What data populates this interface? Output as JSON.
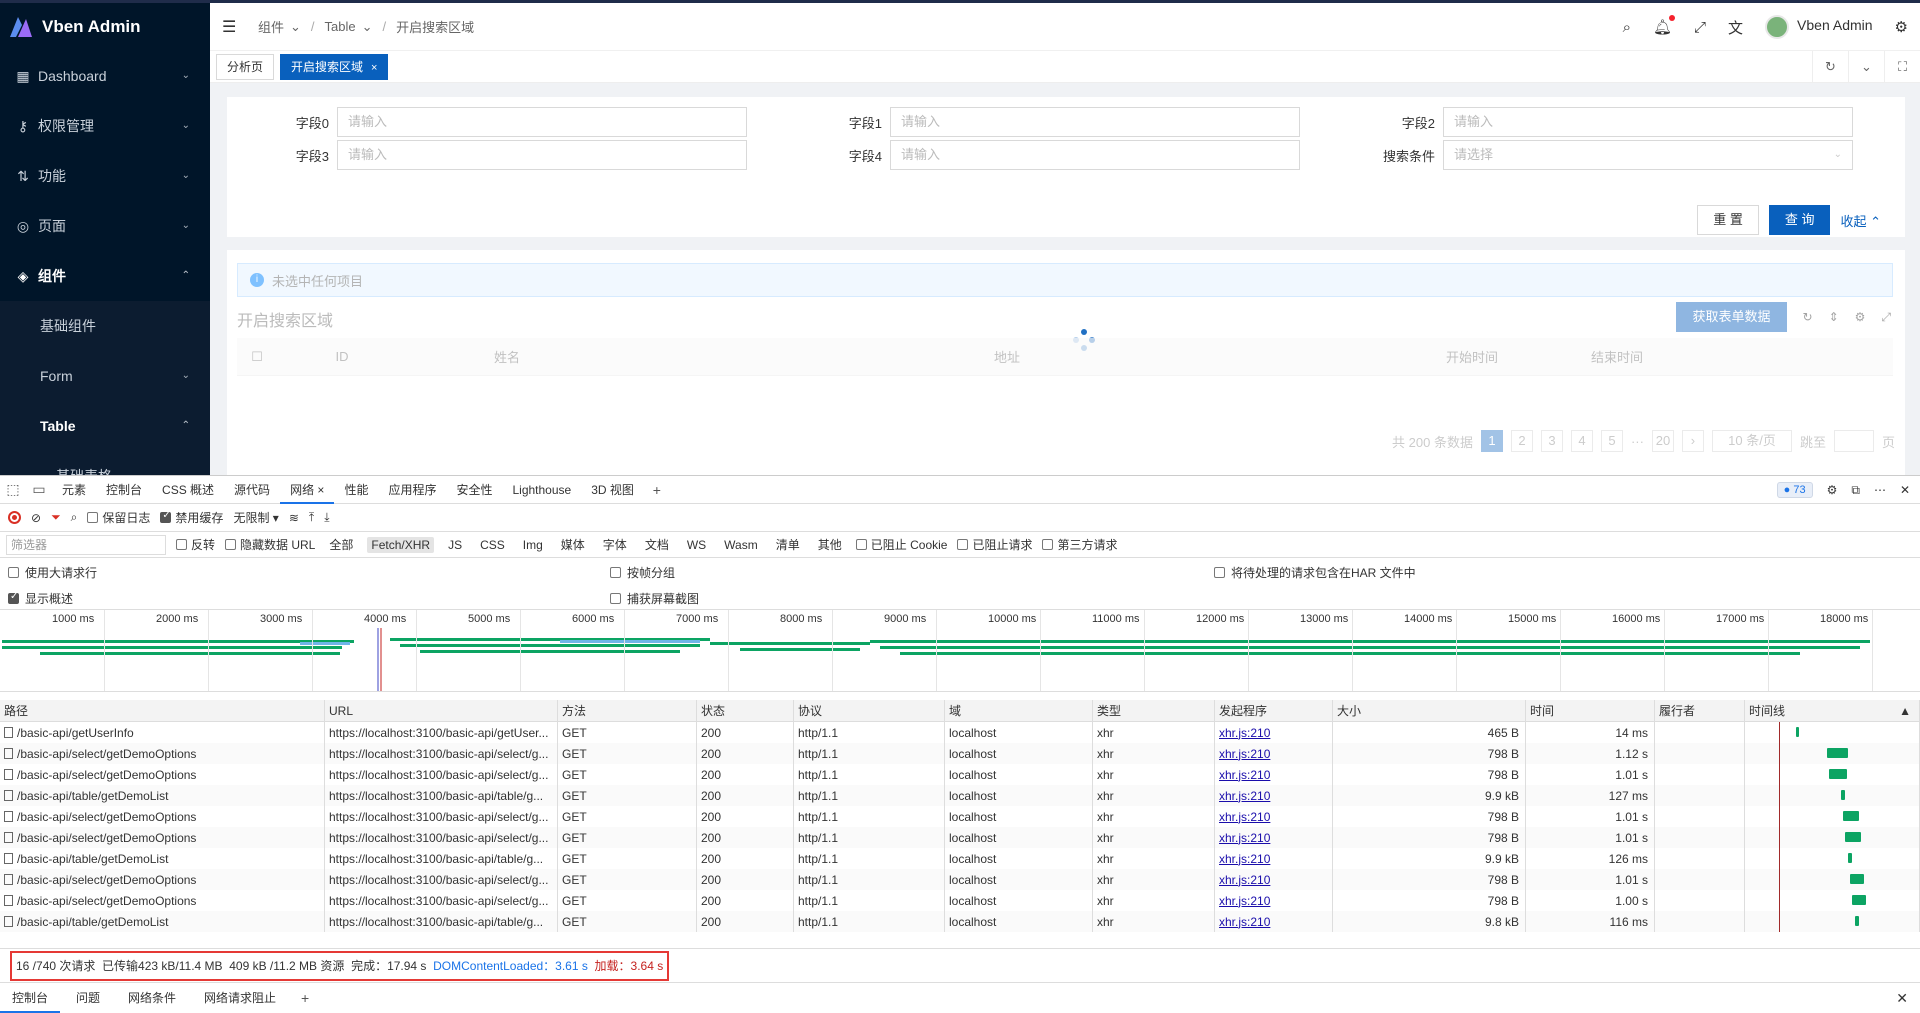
{
  "app": {
    "name": "Vben Admin",
    "user": "Vben Admin"
  },
  "sidebar": {
    "items": [
      {
        "label": "Dashboard",
        "icon": "grid-icon"
      },
      {
        "label": "权限管理",
        "icon": "key-icon"
      },
      {
        "label": "功能",
        "icon": "function-icon"
      },
      {
        "label": "页面",
        "icon": "page-icon"
      },
      {
        "label": "组件",
        "icon": "layers-icon"
      }
    ],
    "sub": [
      {
        "label": "基础组件"
      },
      {
        "label": "Form"
      },
      {
        "label": "Table"
      },
      {
        "label": "基础表格"
      }
    ]
  },
  "breadcrumb": {
    "c1": "组件",
    "c2": "Table",
    "c3": "开启搜索区域"
  },
  "tabs": {
    "t1": "分析页",
    "t2": "开启搜索区域"
  },
  "form": {
    "labels": {
      "f0": "字段0",
      "f1": "字段1",
      "f2": "字段2",
      "f3": "字段3",
      "f4": "字段4",
      "search": "搜索条件"
    },
    "placeholder_input": "请输入",
    "placeholder_select": "请选择",
    "reset": "重 置",
    "query": "查 询",
    "collapse": "收起"
  },
  "table": {
    "alert": "未选中任何项目",
    "title": "开启搜索区域",
    "fetch_btn": "获取表单数据",
    "columns": {
      "id": "ID",
      "name": "姓名",
      "addr": "地址",
      "start": "开始时间",
      "end": "结束时间"
    },
    "pager": {
      "total": "共 200 条数据",
      "p1": "1",
      "p2": "2",
      "p3": "3",
      "p4": "4",
      "p5": "5",
      "dots": "···",
      "p20": "20",
      "size": "10 条/页",
      "jump": "跳至",
      "page": "页"
    }
  },
  "devtools": {
    "tabs": {
      "elements": "元素",
      "console": "控制台",
      "css": "CSS 概述",
      "sources": "源代码",
      "network": "网络",
      "performance": "性能",
      "application": "应用程序",
      "security": "安全性",
      "lighthouse": "Lighthouse",
      "view3d": "3D 视图"
    },
    "badge": "73",
    "toolbar": {
      "preserve": "保留日志",
      "disable_cache": "禁用缓存",
      "throttle": "无限制"
    },
    "filter": {
      "placeholder": "筛选器",
      "invert": "反转",
      "hide_data": "隐藏数据 URL",
      "all": "全部",
      "fetch": "Fetch/XHR",
      "js": "JS",
      "css": "CSS",
      "img": "Img",
      "media": "媒体",
      "font": "字体",
      "doc": "文档",
      "ws": "WS",
      "wasm": "Wasm",
      "manifest": "清单",
      "other": "其他",
      "blocked_cookie": "已阻止 Cookie",
      "blocked_req": "已阻止请求",
      "third_party": "第三方请求"
    },
    "opts": {
      "big_rows": "使用大请求行",
      "group": "按帧分组",
      "har": "将待处理的请求包含在HAR 文件中",
      "overview": "显示概述",
      "screenshots": "捕获屏幕截图"
    },
    "ticks": [
      "1000 ms",
      "2000 ms",
      "3000 ms",
      "4000 ms",
      "5000 ms",
      "6000 ms",
      "7000 ms",
      "8000 ms",
      "9000 ms",
      "10000 ms",
      "11000 ms",
      "12000 ms",
      "13000 ms",
      "14000 ms",
      "15000 ms",
      "16000 ms",
      "17000 ms",
      "18000 ms"
    ],
    "columns": {
      "path": "路径",
      "url": "URL",
      "method": "方法",
      "status": "状态",
      "protocol": "协议",
      "domain": "域",
      "type": "类型",
      "initiator": "发起程序",
      "size": "大小",
      "time": "时间",
      "fulfilled": "履行者",
      "waterfall": "时间线"
    },
    "rows": [
      {
        "path": "/basic-api/getUserInfo",
        "url": "https://localhost:3100/basic-api/getUser...",
        "method": "GET",
        "status": "200",
        "protocol": "http/1.1",
        "domain": "localhost",
        "type": "xhr",
        "initiator": "xhr.js:210",
        "size": "465 B",
        "time": "14 ms",
        "wf_start": 0.29,
        "wf_len": 0.02
      },
      {
        "path": "/basic-api/select/getDemoOptions",
        "url": "https://localhost:3100/basic-api/select/g...",
        "method": "GET",
        "status": "200",
        "protocol": "http/1.1",
        "domain": "localhost",
        "type": "xhr",
        "initiator": "xhr.js:210",
        "size": "798 B",
        "time": "1.12 s",
        "wf_start": 0.47,
        "wf_len": 0.12
      },
      {
        "path": "/basic-api/select/getDemoOptions",
        "url": "https://localhost:3100/basic-api/select/g...",
        "method": "GET",
        "status": "200",
        "protocol": "http/1.1",
        "domain": "localhost",
        "type": "xhr",
        "initiator": "xhr.js:210",
        "size": "798 B",
        "time": "1.01 s",
        "wf_start": 0.48,
        "wf_len": 0.1
      },
      {
        "path": "/basic-api/table/getDemoList",
        "url": "https://localhost:3100/basic-api/table/g...",
        "method": "GET",
        "status": "200",
        "protocol": "http/1.1",
        "domain": "localhost",
        "type": "xhr",
        "initiator": "xhr.js:210",
        "size": "9.9 kB",
        "time": "127 ms",
        "wf_start": 0.55,
        "wf_len": 0.02
      },
      {
        "path": "/basic-api/select/getDemoOptions",
        "url": "https://localhost:3100/basic-api/select/g...",
        "method": "GET",
        "status": "200",
        "protocol": "http/1.1",
        "domain": "localhost",
        "type": "xhr",
        "initiator": "xhr.js:210",
        "size": "798 B",
        "time": "1.01 s",
        "wf_start": 0.56,
        "wf_len": 0.09
      },
      {
        "path": "/basic-api/select/getDemoOptions",
        "url": "https://localhost:3100/basic-api/select/g...",
        "method": "GET",
        "status": "200",
        "protocol": "http/1.1",
        "domain": "localhost",
        "type": "xhr",
        "initiator": "xhr.js:210",
        "size": "798 B",
        "time": "1.01 s",
        "wf_start": 0.57,
        "wf_len": 0.09
      },
      {
        "path": "/basic-api/table/getDemoList",
        "url": "https://localhost:3100/basic-api/table/g...",
        "method": "GET",
        "status": "200",
        "protocol": "http/1.1",
        "domain": "localhost",
        "type": "xhr",
        "initiator": "xhr.js:210",
        "size": "9.9 kB",
        "time": "126 ms",
        "wf_start": 0.59,
        "wf_len": 0.02
      },
      {
        "path": "/basic-api/select/getDemoOptions",
        "url": "https://localhost:3100/basic-api/select/g...",
        "method": "GET",
        "status": "200",
        "protocol": "http/1.1",
        "domain": "localhost",
        "type": "xhr",
        "initiator": "xhr.js:210",
        "size": "798 B",
        "time": "1.01 s",
        "wf_start": 0.6,
        "wf_len": 0.08
      },
      {
        "path": "/basic-api/select/getDemoOptions",
        "url": "https://localhost:3100/basic-api/select/g...",
        "method": "GET",
        "status": "200",
        "protocol": "http/1.1",
        "domain": "localhost",
        "type": "xhr",
        "initiator": "xhr.js:210",
        "size": "798 B",
        "time": "1.00 s",
        "wf_start": 0.61,
        "wf_len": 0.08
      },
      {
        "path": "/basic-api/table/getDemoList",
        "url": "https://localhost:3100/basic-api/table/g...",
        "method": "GET",
        "status": "200",
        "protocol": "http/1.1",
        "domain": "localhost",
        "type": "xhr",
        "initiator": "xhr.js:210",
        "size": "9.8 kB",
        "time": "116 ms",
        "wf_start": 0.63,
        "wf_len": 0.02
      }
    ],
    "summary": {
      "req": "16 /740 次请求",
      "transferred": "已传输423 kB/11.4 MB",
      "resources": "409 kB /11.2 MB 资源",
      "finish": "完成：17.94 s",
      "dcl": "DOMContentLoaded：3.61 s",
      "load": "加载：3.64 s"
    },
    "drawer": {
      "console": "控制台",
      "issues": "问题",
      "conditions": "网络条件",
      "blocking": "网络请求阻止"
    }
  }
}
